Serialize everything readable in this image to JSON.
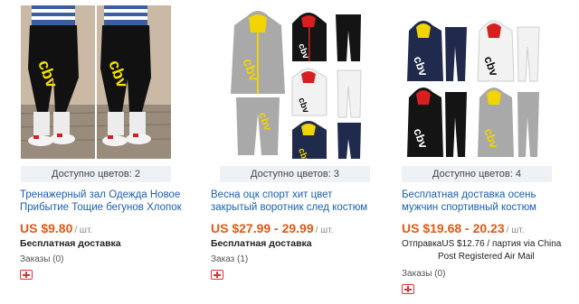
{
  "products": [
    {
      "colors_available": "Доступно цветов: 2",
      "title": "Тренажерный зал Одежда Новое Прибытие Тощие бегунов Хлопок",
      "price": "US $9.80",
      "per_unit": "/ шт.",
      "shipping": "Бесплатная доставка",
      "orders": "Заказы (0)",
      "image": "jogger-pants-black-yellow-cbv"
    },
    {
      "colors_available": "Доступно цветов: 3",
      "title": "Весна оцк спорт хит цвет закрытый воротник след костюм",
      "price": "US $27.99 - 29.99",
      "per_unit": "/ шт.",
      "shipping": "Бесплатная доставка",
      "orders": "Заказ (1)",
      "image": "tracksuits-grey-white-navy-cbv"
    },
    {
      "colors_available": "Доступно цветов: 4",
      "title": "Бесплатная доставка осень мужчин спортивный костюм",
      "price": "US $19.68 - 20.23",
      "per_unit": "/ шт.",
      "shipping_prefix": "Отправка",
      "shipping_cost": "US $12.76",
      "shipping_suffix": "/ партия via China",
      "shipping_method": "Post Registered Air Mail",
      "orders": "Заказы (0)",
      "image": "tracksuits-four-colors-cbv"
    }
  ],
  "colors": {
    "link": "#1a5fb4",
    "price": "#e05a14",
    "bar": "#eef1f5",
    "fav": "#dd3333"
  }
}
